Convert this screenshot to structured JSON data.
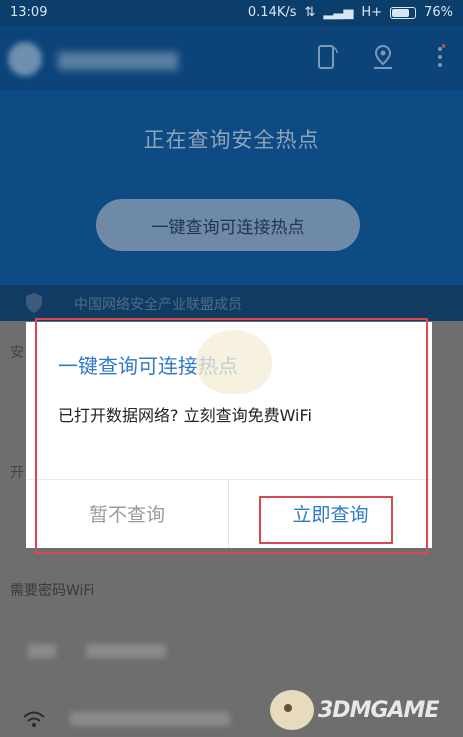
{
  "status_bar": {
    "time": "13:09",
    "network_speed": "0.14K/s",
    "signal": "H+",
    "battery_text": "76%",
    "battery_level": 0.76
  },
  "hero": {
    "title": "正在查询安全热点",
    "button_label": "一键查询可连接热点"
  },
  "member_row": {
    "text": "中国网络安全产业联盟成员"
  },
  "list": {
    "side_labels": [
      "安",
      "开"
    ],
    "password_section": "需要密码WiFi"
  },
  "dialog": {
    "title": "一键查询可连接热点",
    "message": "已打开数据网络? 立刻查询免费WiFi",
    "cancel_label": "暂不查询",
    "confirm_label": "立即查询"
  },
  "watermark": {
    "text": "3DMGAME"
  },
  "colors": {
    "accent": "#2f79c6",
    "highlight": "#d9494f",
    "header_bg": "#0c447a"
  }
}
